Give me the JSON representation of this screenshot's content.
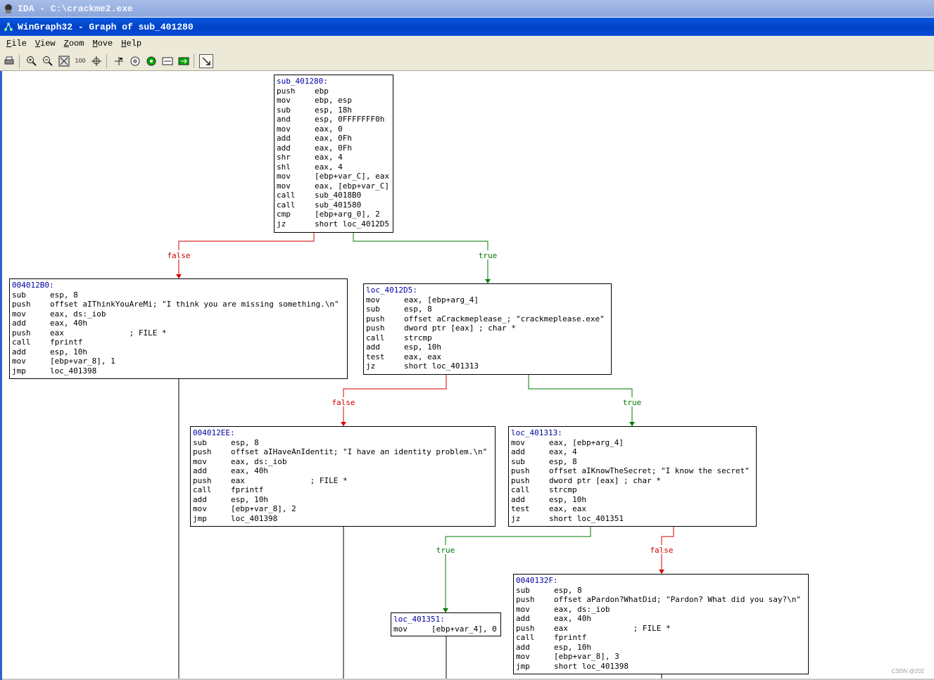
{
  "window": {
    "ida_title": "IDA - C:\\crackme2.exe",
    "graph_title": "WinGraph32 - Graph of sub_401280"
  },
  "menu": [
    "File",
    "View",
    "Zoom",
    "Move",
    "Help"
  ],
  "toolbar_icons": [
    "print-icon",
    "zoom-in-icon",
    "zoom-out-icon",
    "fit-window-icon",
    "zoom-100-icon",
    "center-icon",
    "move-icon",
    "radar-icon",
    "green-dot-icon",
    "layout-icon",
    "navigate-icon",
    "select-arrow-icon"
  ],
  "toolbar_100": "100",
  "nodes": [
    {
      "id": "n0",
      "label": "sub_401280:",
      "lines": [
        [
          "push",
          "ebp"
        ],
        [
          "mov",
          "ebp, esp"
        ],
        [
          "sub",
          "esp, 18h"
        ],
        [
          "and",
          "esp, 0FFFFFFF0h"
        ],
        [
          "mov",
          "eax, 0"
        ],
        [
          "add",
          "eax, 0Fh"
        ],
        [
          "add",
          "eax, 0Fh"
        ],
        [
          "shr",
          "eax, 4"
        ],
        [
          "shl",
          "eax, 4"
        ],
        [
          "mov",
          "[ebp+var_C], eax"
        ],
        [
          "mov",
          "eax, [ebp+var_C]"
        ],
        [
          "call",
          "sub_4018B0"
        ],
        [
          "call",
          "sub_401580"
        ],
        [
          "cmp",
          "[ebp+arg_0], 2"
        ],
        [
          "jz",
          "short loc_4012D5"
        ]
      ]
    },
    {
      "id": "n1",
      "label": "004012B0:",
      "lines": [
        [
          "sub",
          "esp, 8"
        ],
        [
          "push",
          "offset aIThinkYouAreMi; \"I think you are missing something.\\n\""
        ],
        [
          "mov",
          "eax, ds:_iob"
        ],
        [
          "add",
          "eax, 40h"
        ],
        [
          "push",
          "eax              ; FILE *"
        ],
        [
          "call",
          "fprintf"
        ],
        [
          "add",
          "esp, 10h"
        ],
        [
          "mov",
          "[ebp+var_8], 1"
        ],
        [
          "jmp",
          "loc_401398"
        ]
      ]
    },
    {
      "id": "n2",
      "label": "loc_4012D5:",
      "lines": [
        [
          "mov",
          "eax, [ebp+arg_4]"
        ],
        [
          "sub",
          "esp, 8"
        ],
        [
          "push",
          "offset aCrackmeplease_; \"crackmeplease.exe\""
        ],
        [
          "push",
          "dword ptr [eax] ; char *"
        ],
        [
          "call",
          "strcmp"
        ],
        [
          "add",
          "esp, 10h"
        ],
        [
          "test",
          "eax, eax"
        ],
        [
          "jz",
          "short loc_401313"
        ]
      ]
    },
    {
      "id": "n3",
      "label": "004012EE:",
      "lines": [
        [
          "sub",
          "esp, 8"
        ],
        [
          "push",
          "offset aIHaveAnIdentit; \"I have an identity problem.\\n\""
        ],
        [
          "mov",
          "eax, ds:_iob"
        ],
        [
          "add",
          "eax, 40h"
        ],
        [
          "push",
          "eax              ; FILE *"
        ],
        [
          "call",
          "fprintf"
        ],
        [
          "add",
          "esp, 10h"
        ],
        [
          "mov",
          "[ebp+var_8], 2"
        ],
        [
          "jmp",
          "loc_401398"
        ]
      ]
    },
    {
      "id": "n4",
      "label": "loc_401313:",
      "lines": [
        [
          "mov",
          "eax, [ebp+arg_4]"
        ],
        [
          "add",
          "eax, 4"
        ],
        [
          "sub",
          "esp, 8"
        ],
        [
          "push",
          "offset aIKnowTheSecret; \"I know the secret\""
        ],
        [
          "push",
          "dword ptr [eax] ; char *"
        ],
        [
          "call",
          "strcmp"
        ],
        [
          "add",
          "esp, 10h"
        ],
        [
          "test",
          "eax, eax"
        ],
        [
          "jz",
          "short loc_401351"
        ]
      ]
    },
    {
      "id": "n5",
      "label": "loc_401351:",
      "lines": [
        [
          "mov",
          "[ebp+var_4], 0"
        ]
      ]
    },
    {
      "id": "n6",
      "label": "0040132F:",
      "lines": [
        [
          "sub",
          "esp, 8"
        ],
        [
          "push",
          "offset aPardon?WhatDid; \"Pardon? What did you say?\\n\""
        ],
        [
          "mov",
          "eax, ds:_iob"
        ],
        [
          "add",
          "eax, 40h"
        ],
        [
          "push",
          "eax              ; FILE *"
        ],
        [
          "call",
          "fprintf"
        ],
        [
          "add",
          "esp, 10h"
        ],
        [
          "mov",
          "[ebp+var_8], 3"
        ],
        [
          "jmp",
          "short loc_401398"
        ]
      ]
    }
  ],
  "edges": [
    {
      "from": "n0",
      "to": "n1",
      "label": "false",
      "color": "#d40000"
    },
    {
      "from": "n0",
      "to": "n2",
      "label": "true",
      "color": "#007a00"
    },
    {
      "from": "n2",
      "to": "n3",
      "label": "false",
      "color": "#d40000"
    },
    {
      "from": "n2",
      "to": "n4",
      "label": "true",
      "color": "#007a00"
    },
    {
      "from": "n4",
      "to": "n5",
      "label": "true",
      "color": "#007a00"
    },
    {
      "from": "n4",
      "to": "n6",
      "label": "false",
      "color": "#d40000"
    }
  ],
  "watermark": "CSDN @202"
}
